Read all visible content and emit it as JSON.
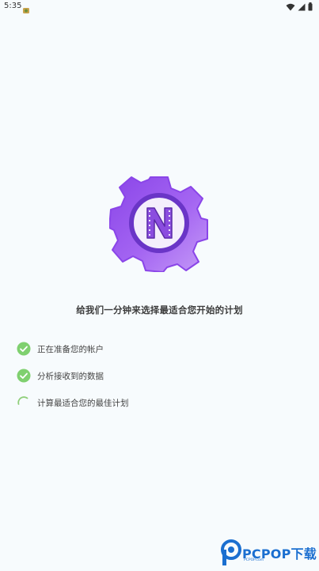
{
  "status_bar": {
    "time": "5:35",
    "icons": [
      "app-notification-icon",
      "wifi-icon",
      "signal-icon",
      "battery-icon"
    ]
  },
  "logo": {
    "letter": "N",
    "gear_color": "#9b5cf0",
    "ring_color": "#6a35c7"
  },
  "headline": "给我们一分钟来选择最适合您开始的计划",
  "steps": [
    {
      "label": "正在准备您的帐户",
      "status": "done"
    },
    {
      "label": "分析接收到的数据",
      "status": "done"
    },
    {
      "label": "计算最适合您的最佳计划",
      "status": "loading"
    }
  ],
  "colors": {
    "background": "#f7fbfd",
    "check": "#7fd06f",
    "spinner": "#8fcf7a"
  },
  "watermark": {
    "text": "PCPOP下载",
    "subtext": "PCPOP.com"
  }
}
